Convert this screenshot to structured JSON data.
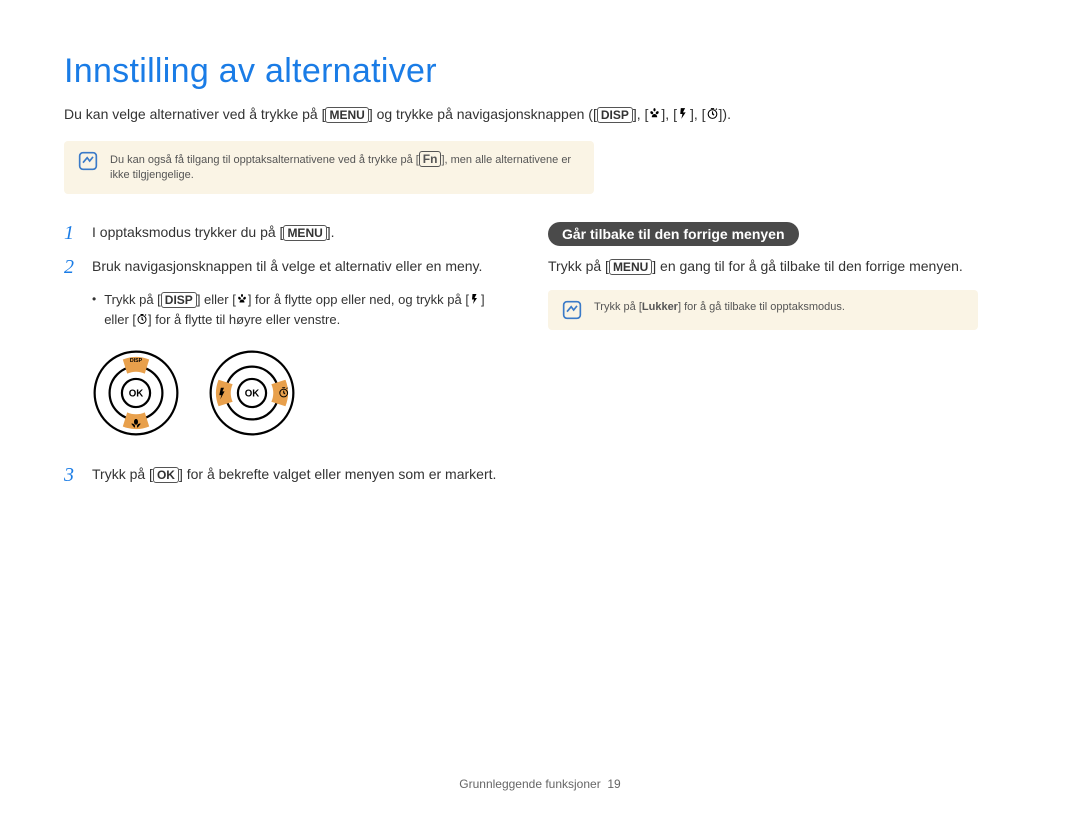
{
  "title": "Innstilling av alternativer",
  "intro": {
    "pre": "Du kan velge alternativer ved å trykke på [",
    "menu": "MENU",
    "mid": "] og trykke på navigasjonsknappen ([",
    "disp": "DISP",
    "post": "]).",
    "icons_sep": "], ["
  },
  "note1": {
    "pre": "Du kan også få tilgang til opptaksalternativene ved å trykke på [",
    "fn": "Fn",
    "post": "], men alle alternativene er ikke tilgjengelige."
  },
  "steps": {
    "s1": {
      "num": "1",
      "pre": "I opptaksmodus trykker du på [",
      "btn": "MENU",
      "post": "]."
    },
    "s2": {
      "num": "2",
      "text": "Bruk navigasjonsknappen til å velge et alternativ eller en meny."
    },
    "s2_bullet": {
      "pre": "Trykk på [",
      "disp": "DISP",
      "mid1": "] eller [",
      "mid2": "] for å flytte opp eller ned, og trykk på [",
      "mid3": "] eller [",
      "post": "] for å flytte til høyre eller venstre."
    },
    "s3": {
      "num": "3",
      "pre": "Trykk på [",
      "btn": "OK",
      "post": "] for å bekrefte valget eller menyen som er markert."
    }
  },
  "right": {
    "pill": "Går tilbake til den forrige menyen",
    "para_pre": "Trykk på [",
    "para_btn": "MENU",
    "para_post": "] en gang til for å gå tilbake til den forrige menyen.",
    "note_pre": "Trykk på [",
    "note_btn": "Lukker",
    "note_post": "] for å gå tilbake til opptaksmodus."
  },
  "footer": {
    "label": "Grunnleggende funksjoner",
    "page": "19"
  },
  "icons": {
    "macro": "macro-flower-icon",
    "flash": "flash-icon",
    "timer": "self-timer-icon",
    "disp": "DISP",
    "ok": "OK"
  }
}
